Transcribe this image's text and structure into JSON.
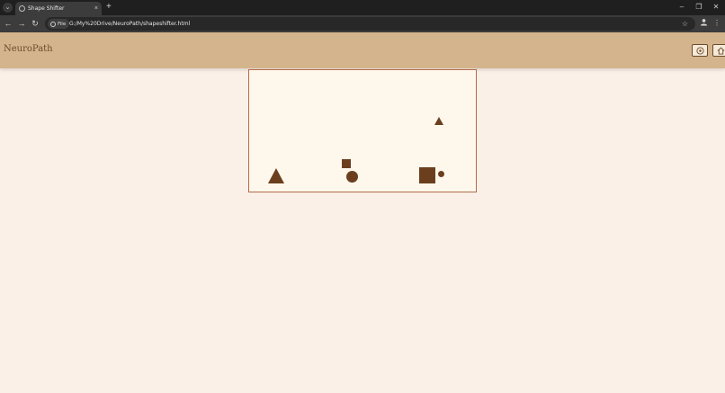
{
  "browser": {
    "tab_title": "Shape Shifter",
    "new_tab_glyph": "+",
    "tab_close_glyph": "×",
    "scheme_label": "File",
    "url": "G:/My%20Drive/NeuroPath/shapeshifter.html"
  },
  "app": {
    "brand": "NeuroPath",
    "header_buttons": [
      "target-icon",
      "home-icon"
    ]
  },
  "colors": {
    "header_bg": "#d4b48c",
    "page_bg": "#faf0e7",
    "board_bg": "#fef8ec",
    "board_border": "#b46a4a",
    "shape_color": "#6b3f1e"
  },
  "board": {
    "shapes": [
      "triangle",
      "triangle",
      "square",
      "circle",
      "square",
      "circle"
    ]
  }
}
